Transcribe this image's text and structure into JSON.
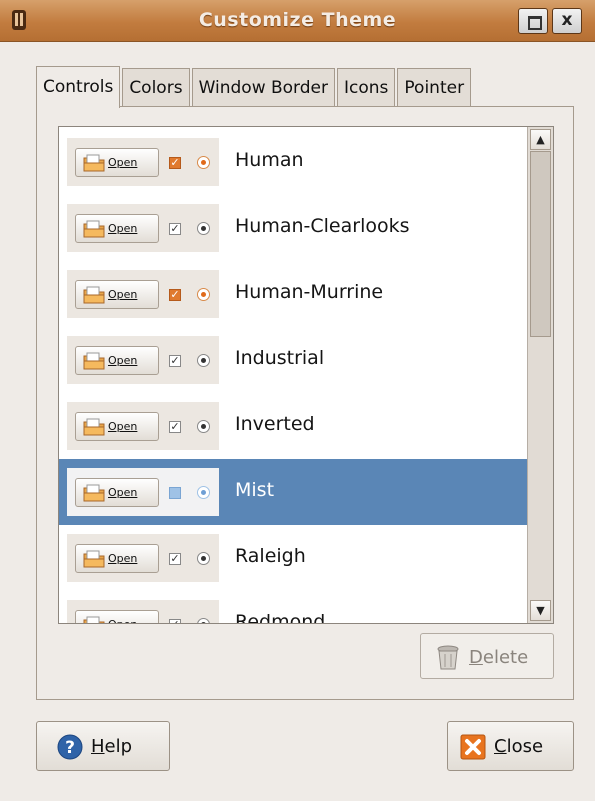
{
  "window": {
    "title": "Customize Theme",
    "close_glyph": "x"
  },
  "tabs": [
    {
      "label": "Controls",
      "active": true
    },
    {
      "label": "Colors",
      "active": false
    },
    {
      "label": "Window Border",
      "active": false
    },
    {
      "label": "Icons",
      "active": false
    },
    {
      "label": "Pointer",
      "active": false
    }
  ],
  "preview_button_label": "Open",
  "themes": [
    {
      "name": "Human",
      "style": "orange",
      "selected": false
    },
    {
      "name": "Human-Clearlooks",
      "style": "grey",
      "selected": false
    },
    {
      "name": "Human-Murrine",
      "style": "orange",
      "selected": false
    },
    {
      "name": "Industrial",
      "style": "grey",
      "selected": false
    },
    {
      "name": "Inverted",
      "style": "grey",
      "selected": false
    },
    {
      "name": "Mist",
      "style": "blue",
      "selected": true
    },
    {
      "name": "Raleigh",
      "style": "grey",
      "selected": false
    },
    {
      "name": "Redmond",
      "style": "grey",
      "selected": false
    }
  ],
  "buttons": {
    "delete_label": "Delete",
    "help_label": "Help",
    "close_label": "Close"
  },
  "icons": {
    "app": "app-icon",
    "maximize": "maximize-icon",
    "close": "close-icon",
    "delete": "trash-icon",
    "help": "help-icon",
    "dialog_close": "close-x-icon"
  },
  "colors": {
    "titlebar": "#c27c3f",
    "selection": "#5a86b6",
    "accent_orange": "#e07a2e"
  }
}
